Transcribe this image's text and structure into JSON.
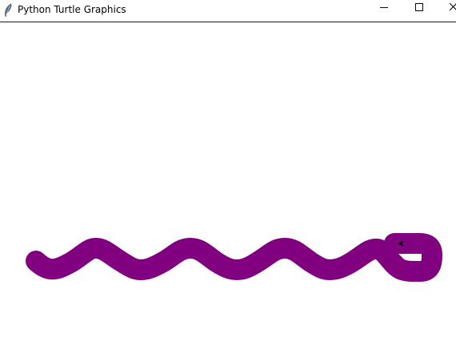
{
  "window": {
    "title": "Python Turtle Graphics"
  },
  "icons": {
    "app": "feather-icon",
    "minimize": "minimize-icon",
    "maximize": "maximize-icon",
    "close": "close-icon",
    "turtle": "turtle-arrow-cursor"
  },
  "drawing": {
    "pen_color": "#800080",
    "cursor_color": "#000000",
    "pattern": "wavy line ending in a hook"
  }
}
